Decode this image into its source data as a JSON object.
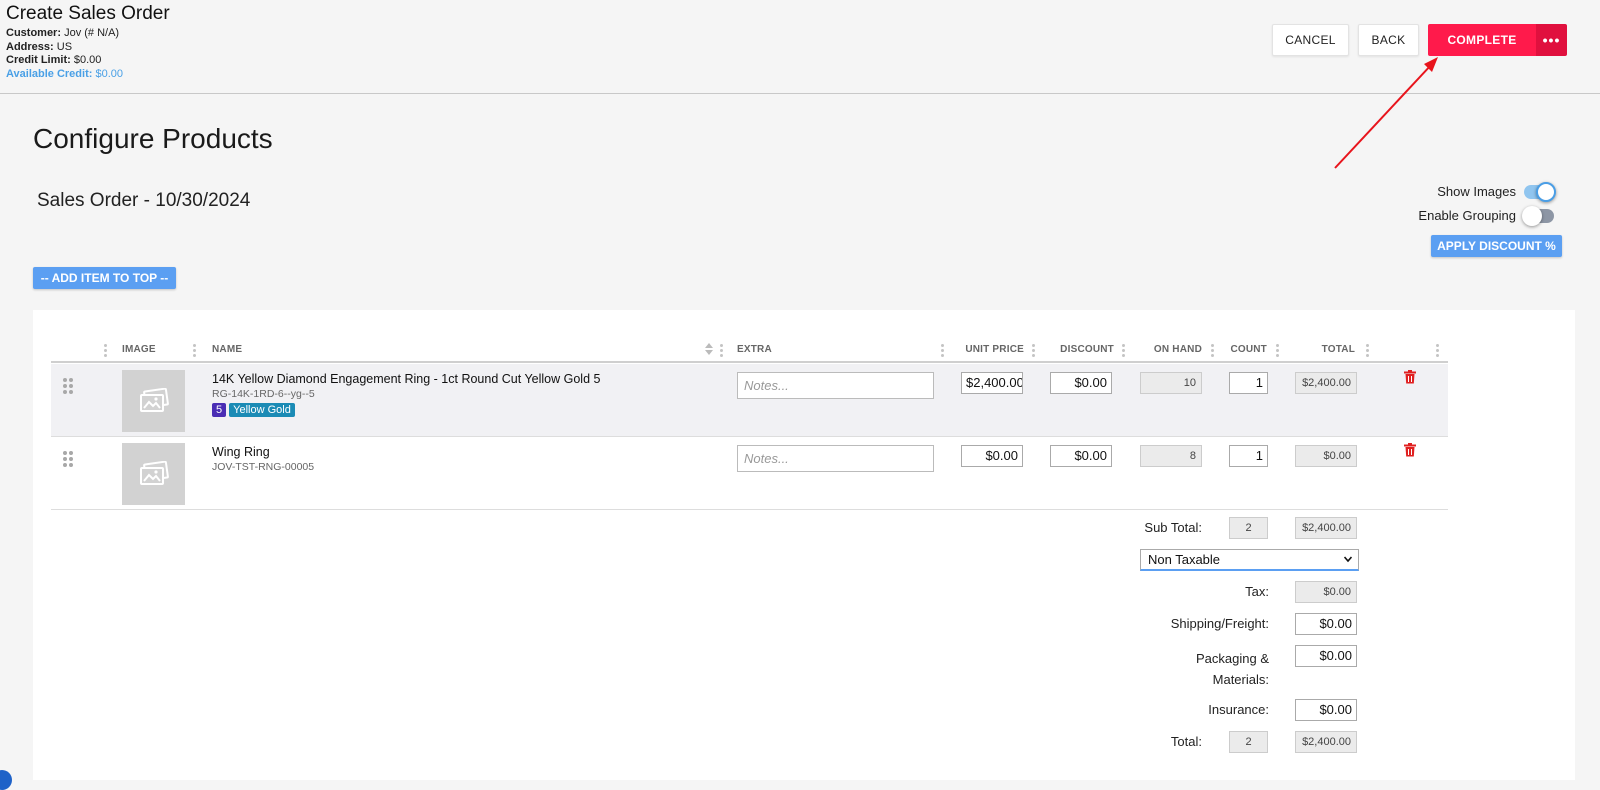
{
  "header": {
    "title": "Create Sales Order",
    "customer_label": "Customer:",
    "customer_value": "Jov (# N/A)",
    "address_label": "Address:",
    "address_value": "US",
    "credit_limit_label": "Credit Limit:",
    "credit_limit_value": "$0.00",
    "available_credit_label": "Available Credit:",
    "available_credit_value": "$0.00",
    "cancel_label": "CANCEL",
    "back_label": "BACK",
    "complete_label": "COMPLETE",
    "more_label": "•••"
  },
  "page": {
    "title": "Configure Products",
    "subtitle": "Sales Order - 10/30/2024",
    "show_images_label": "Show Images",
    "show_images_on": true,
    "enable_grouping_label": "Enable Grouping",
    "enable_grouping_on": false,
    "apply_discount_label": "APPLY DISCOUNT %",
    "add_item_label": "-- ADD ITEM TO TOP --"
  },
  "table": {
    "columns": [
      "IMAGE",
      "NAME",
      "EXTRA",
      "UNIT PRICE",
      "DISCOUNT",
      "ON HAND",
      "COUNT",
      "TOTAL"
    ],
    "notes_placeholder": "Notes...",
    "rows": [
      {
        "name": "14K Yellow Diamond Engagement Ring - 1ct Round Cut Yellow Gold 5",
        "sku": "RG-14K-1RD-6--yg--5",
        "badges": [
          "5",
          "Yellow Gold"
        ],
        "unit_price": "$2,400.00",
        "discount": "$0.00",
        "on_hand": "10",
        "count": "1",
        "total": "$2,400.00"
      },
      {
        "name": "Wing Ring",
        "sku": "JOV-TST-RNG-00005",
        "badges": [],
        "unit_price": "$0.00",
        "discount": "$0.00",
        "on_hand": "8",
        "count": "1",
        "total": "$0.00"
      }
    ]
  },
  "totals": {
    "sub_total_label": "Sub Total:",
    "sub_total_count": "2",
    "sub_total_value": "$2,400.00",
    "tax_option": "Non Taxable",
    "tax_label": "Tax:",
    "tax_value": "$0.00",
    "shipping_label": "Shipping/Freight:",
    "shipping_value": "$0.00",
    "packaging_label_1": "Packaging &",
    "packaging_label_2": "Materials:",
    "packaging_value": "$0.00",
    "insurance_label": "Insurance:",
    "insurance_value": "$0.00",
    "total_label": "Total:",
    "total_count": "2",
    "total_value": "$2,400.00"
  },
  "colors": {
    "complete": "#ff1a4b",
    "complete_more": "#e0103e",
    "accent_blue": "#5b9ff2",
    "credit_text": "#4aa0e6",
    "annotation_arrow": "#e8141c"
  }
}
